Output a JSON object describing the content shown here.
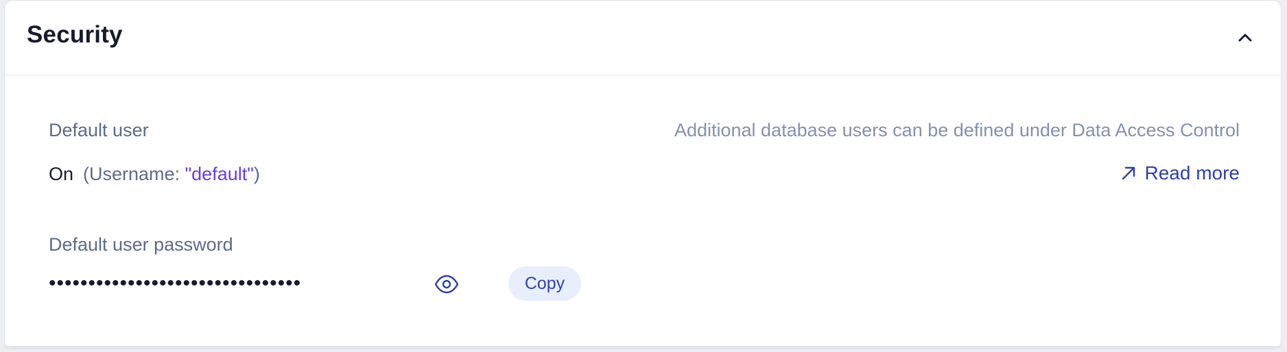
{
  "section": {
    "title": "Security",
    "collapse_icon": "chevron-up-icon"
  },
  "default_user": {
    "label": "Default user",
    "state": "On",
    "username_prefix": "(Username: ",
    "username_value": "\"default\"",
    "username_suffix": ")",
    "hint": "Additional database users can be defined under Data Access Control",
    "read_more_label": "Read more",
    "read_more_icon": "arrow-up-right-icon"
  },
  "password": {
    "label": "Default user password",
    "masked_value": "••••••••••••••••••••••••••••••••",
    "reveal_icon": "eye-icon",
    "copy_label": "Copy"
  },
  "colors": {
    "accent": "#2f3fae",
    "username": "#6a3dd8",
    "label": "#5b6b8a",
    "hint": "#8391ad",
    "copy_bg": "#e8eefc"
  }
}
